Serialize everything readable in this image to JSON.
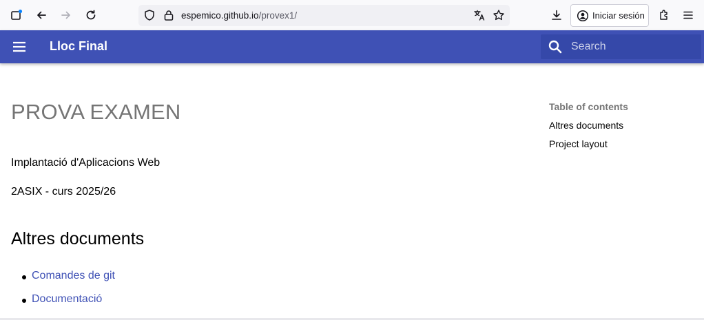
{
  "browser": {
    "url_domain": "espemico.github.io",
    "url_path": "/provex1/",
    "signin_label": "Iniciar sesión",
    "icons": [
      "tab-view-icon",
      "back-icon",
      "forward-icon",
      "reload-icon",
      "shield-icon",
      "lock-icon",
      "translate-icon",
      "bookmark-star-icon",
      "download-icon",
      "account-icon",
      "extensions-icon",
      "menu-icon"
    ]
  },
  "header": {
    "title": "Lloc Final",
    "search_placeholder": "Search",
    "color": "#3f51b5"
  },
  "main": {
    "page_title": "PROVA EXAMEN",
    "paragraphs": [
      "Implantació d'Aplicacions Web",
      "2ASIX - curs 2025/26"
    ],
    "section_heading": "Altres documents",
    "links": [
      "Comandes de git",
      "Documentació"
    ],
    "link_color": "#3f51b5"
  },
  "toc": {
    "title": "Table of contents",
    "items": [
      "Altres documents",
      "Project layout"
    ]
  }
}
